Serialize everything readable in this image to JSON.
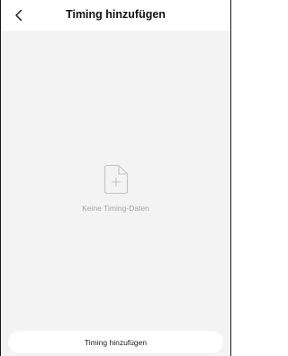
{
  "header": {
    "title": "Timing hinzufügen",
    "back_icon": "chevron-left-icon"
  },
  "empty_state": {
    "icon": "document-add-icon",
    "message": "Keine Timing-Daten"
  },
  "footer": {
    "add_button_label": "Timing hinzufügen"
  },
  "colors": {
    "background": "#f3f3f4",
    "muted_text": "#a5a5a8",
    "title_text": "#111111"
  }
}
